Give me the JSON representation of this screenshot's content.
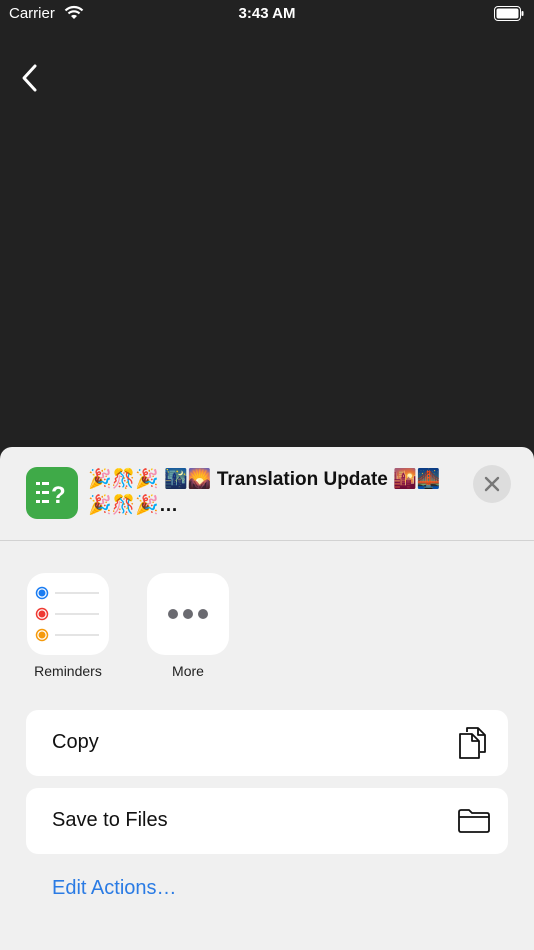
{
  "status_bar": {
    "carrier": "Carrier",
    "time": "3:43 AM"
  },
  "share_sheet": {
    "title": "🎉🎊🎉 🌃🌄 Translation Update 🌇🌉🎉🎊🎉…",
    "apps": [
      {
        "label": "Reminders"
      },
      {
        "label": "More"
      }
    ],
    "actions": [
      {
        "label": "Copy",
        "icon": "copy-icon"
      },
      {
        "label": "Save to Files",
        "icon": "folder-icon"
      }
    ],
    "edit_actions_label": "Edit Actions…"
  },
  "colors": {
    "app_icon": "#3faa48",
    "link": "#2a7be4",
    "background": "#222222"
  }
}
